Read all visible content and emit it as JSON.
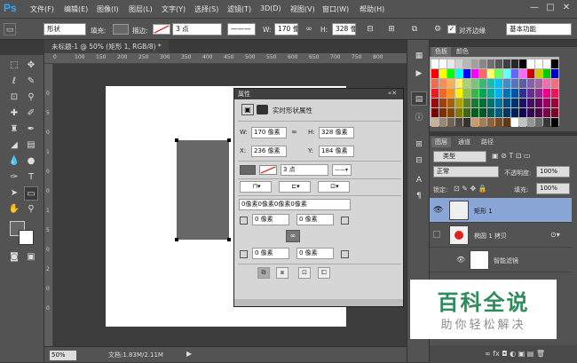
{
  "menubar": {
    "logo": "Ps",
    "items": [
      "文件(F)",
      "编辑(E)",
      "图像(I)",
      "图层(L)",
      "文字(Y)",
      "选择(S)",
      "滤镜(T)",
      "3D(D)",
      "视图(V)",
      "窗口(W)",
      "帮助(H)"
    ],
    "window_controls": {
      "minimize": "—",
      "restore": "□",
      "close": "✕"
    }
  },
  "options": {
    "mode": "形状",
    "fill_label": "填充:",
    "stroke_label": "描边:",
    "stroke_size": "3 点",
    "w_label": "W:",
    "w_value": "170 像",
    "h_label": "H:",
    "h_value": "328 像",
    "align_label": "对齐边缘",
    "workspace": "基本功能"
  },
  "document_tab": {
    "label": "未标题-1 @ 50% (矩形 1, RGB/8) *",
    "close": "×"
  },
  "ruler_top_numbers": [
    "0",
    "100",
    "150",
    "200",
    "250",
    "300",
    "350",
    "400",
    "450",
    "500",
    "550",
    "600",
    "650",
    "700",
    "750",
    "800"
  ],
  "ruler_left_numbers": [
    "0",
    "5",
    "0",
    "1",
    "0",
    "0",
    "1",
    "5",
    "0",
    "2",
    "0",
    "0"
  ],
  "status": {
    "zoom": "50%",
    "doc": "文档:1.83M/2.11M"
  },
  "properties": {
    "tab_label": "属性",
    "header": "实时形状属性",
    "w_label": "W:",
    "w_value": "170 像素",
    "h_label": "H:",
    "h_value": "328 像素",
    "x_label": "X:",
    "x_value": "236 像素",
    "y_label": "Y:",
    "y_value": "184 像素",
    "stroke_size": "3 点",
    "radius_all": "0像素0像素0像素0像素",
    "radius_tl": "0 像素",
    "radius_tr": "0 像素",
    "radius_bl": "0 像素",
    "radius_br": "0 像素"
  },
  "color_panel": {
    "tab1": "色板",
    "tab2": "颜色"
  },
  "layers_panel": {
    "tabs": [
      "图层",
      "通道",
      "路径"
    ],
    "kind": "类型",
    "blend_mode": "正常",
    "opacity_label": "不透明度:",
    "opacity": "100%",
    "lock_label": "锁定:",
    "fill_label": "填充:",
    "fill": "100%",
    "layers": [
      {
        "name": "矩形 1"
      },
      {
        "name": "椭圆 1 拷贝"
      },
      {
        "name": "智能滤镜"
      }
    ]
  },
  "watermark": {
    "line1": "百科全说",
    "line2": "助你轻松解决"
  },
  "colors": {
    "accent": "#31a8ff",
    "shape": "#676767",
    "watermark_green": "#2c8c5a"
  },
  "swatch_colors": [
    [
      "#ffffff",
      "#ffffff",
      "#e8e8e8",
      "#d0d0d0",
      "#b8b8b8",
      "#a0a0a0",
      "#888888",
      "#707070",
      "#585858",
      "#404040",
      "#282828",
      "#000000",
      "#ffffff",
      "#ffffff",
      "#ffffff",
      "#000000"
    ],
    [
      "#ff0000",
      "#ffff00",
      "#00ff00",
      "#00ffff",
      "#0000ff",
      "#ff00ff",
      "#ff6666",
      "#ffff66",
      "#66ff66",
      "#66ffff",
      "#6666ff",
      "#ff66ff",
      "#cc0000",
      "#cccc00",
      "#00cc00",
      "#0000cc"
    ],
    [
      "#f26c4f",
      "#f68e55",
      "#fbaf5c",
      "#fff467",
      "#acd372",
      "#7cc576",
      "#3bb878",
      "#1abbb4",
      "#00bff3",
      "#438cca",
      "#5574b9",
      "#605ca8",
      "#855fa8",
      "#a763a8",
      "#f06ea9",
      "#f26d7d"
    ],
    [
      "#ed1c24",
      "#f26522",
      "#f7941d",
      "#fff200",
      "#8dc73f",
      "#39b54a",
      "#00a651",
      "#00a99d",
      "#00aeef",
      "#0072bc",
      "#0054a6",
      "#2e3192",
      "#662d91",
      "#92278f",
      "#ec008c",
      "#ed145b"
    ],
    [
      "#9e0b0f",
      "#a0410d",
      "#a36209",
      "#aba000",
      "#598527",
      "#1a7b30",
      "#007236",
      "#00746b",
      "#0076a3",
      "#004b80",
      "#003471",
      "#1b1464",
      "#440e62",
      "#630460",
      "#9e005d",
      "#9e0039"
    ],
    [
      "#790000",
      "#7b2e00",
      "#7d4900",
      "#827b00",
      "#406618",
      "#005e20",
      "#005826",
      "#005952",
      "#005b7f",
      "#003663",
      "#002157",
      "#0d004c",
      "#32004b",
      "#4b0049",
      "#7b0046",
      "#7a0026"
    ],
    [
      "#c7b299",
      "#998675",
      "#736357",
      "#534741",
      "#37302d",
      "#c69c6d",
      "#a67c52",
      "#8c6239",
      "#754c24",
      "#603913",
      "#ffffff",
      "#c2c2c2",
      "#959595",
      "#6d6d6d",
      "#363636",
      "#000000"
    ]
  ]
}
